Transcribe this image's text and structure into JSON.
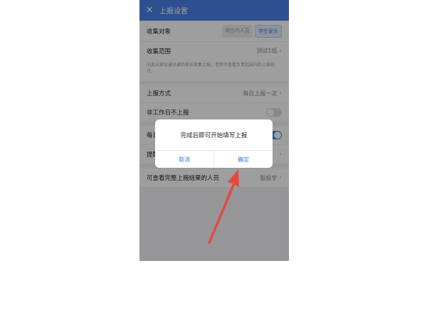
{
  "header": {
    "title": "上报设置",
    "close_icon": "close-icon"
  },
  "collect_target": {
    "label": "收集对象",
    "options": [
      "单位内人员",
      "学生家长"
    ],
    "selected": "学生家长"
  },
  "collect_scope": {
    "label": "收集范围",
    "value": "测试1班"
  },
  "scope_note": "向加入家校通讯录的家长收集上报，老师可查看负责范围内的上报统计。",
  "report_method": {
    "label": "上报方式",
    "value": "每日上报一次"
  },
  "skip_nonworkday": {
    "label": "非工作日不上报",
    "enabled": false
  },
  "daily_row": {
    "label": "每日提醒",
    "enabled": true
  },
  "remind_row": {
    "label": "提醒",
    "value": ""
  },
  "viewers": {
    "label": "可查看完整上报结果的人员",
    "value": "殷振宇"
  },
  "dialog": {
    "message": "完成后即可开始填写上报",
    "cancel": "取消",
    "confirm": "确定"
  },
  "colors": {
    "accent": "#4a82e8",
    "annotation_arrow": "#e8473d"
  }
}
